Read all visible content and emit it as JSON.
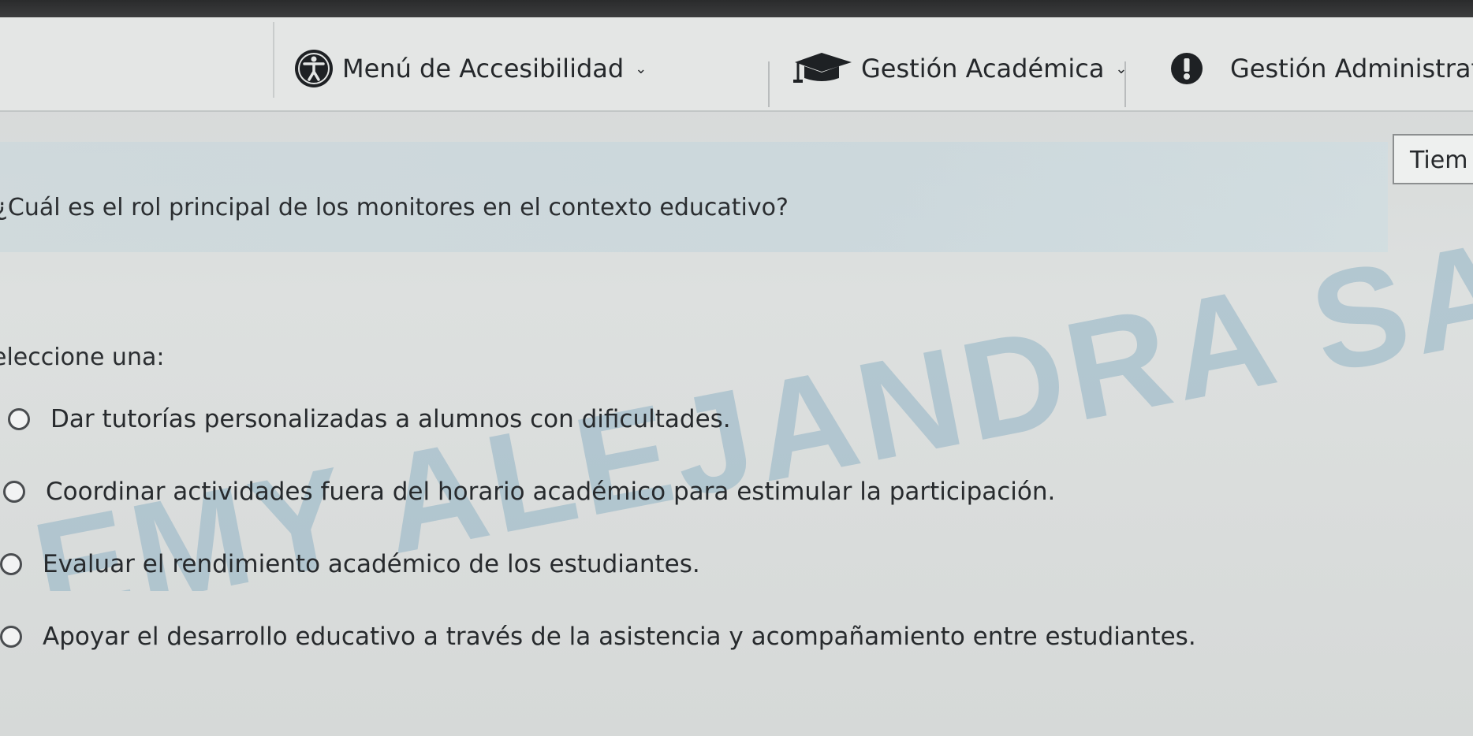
{
  "navbar": {
    "accessibility_label": "Menú de Accesibilidad",
    "academic_label": "Gestión Académica",
    "admin_label": "Gestión Administrat"
  },
  "timer": {
    "label": "Tiem"
  },
  "question": {
    "text": "¿Cuál es el rol principal de los monitores en el contexto educativo?",
    "select_label": "eleccione una:",
    "options": [
      {
        "label": "Dar tutorías personalizadas a alumnos con dificultades."
      },
      {
        "label": "Coordinar actividades fuera del horario académico para estimular la participación."
      },
      {
        "label": "Evaluar el rendimiento académico de los estudiantes."
      },
      {
        "label": "Apoyar el desarrollo educativo a través de la asistencia y acompañamiento entre estudiantes."
      }
    ]
  },
  "watermark": {
    "text": "EMY ALEJANDRA SANTA"
  },
  "colors": {
    "watermark": "#8fb3c4",
    "navbar_bg": "#e4e6e5",
    "page_bg": "#d9dcdc"
  },
  "icons": [
    "accessibility-icon",
    "graduation-cap-icon",
    "alert-icon",
    "chevron-down-icon"
  ]
}
